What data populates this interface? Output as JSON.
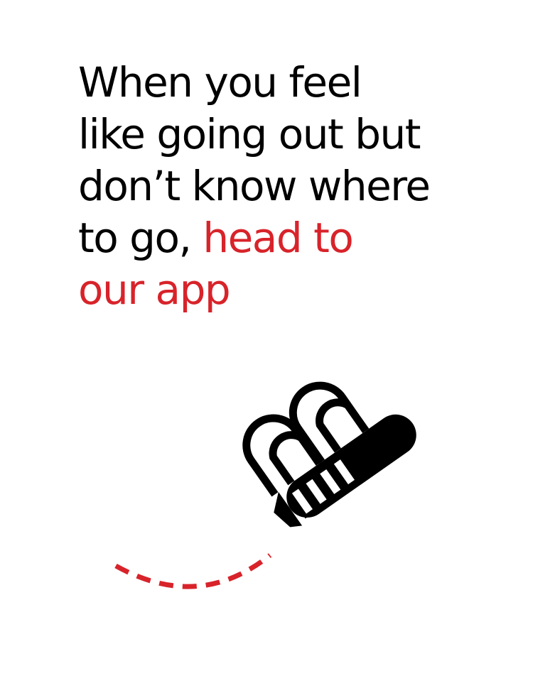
{
  "headline": {
    "line_1": "When you feel",
    "line_2": "like going out but",
    "line_3": "don’t know where",
    "line_4_plain": "to go, ",
    "line_4_accent": "head to",
    "line_5_accent": "our app"
  },
  "colors": {
    "text": "#000000",
    "accent": "#d8232a",
    "background": "#ffffff"
  },
  "icons": {
    "main": "toothbrush-icon",
    "trail": "dashed-trail-path"
  }
}
